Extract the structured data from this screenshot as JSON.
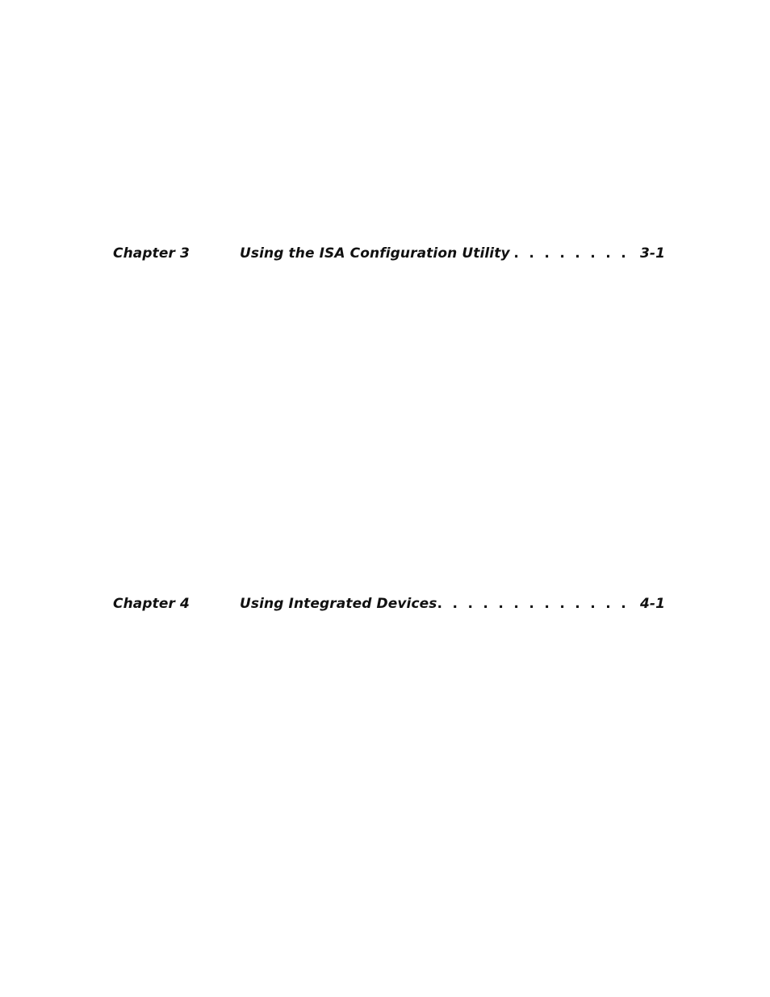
{
  "toc": {
    "entries": [
      {
        "chapter": "Chapter 3",
        "title": "Using the ISA Configuration Utility",
        "leader": ". . . . . . . . . . . . . . . . . . . . . . . . . . . . . . . . . . . . . . . .",
        "page": "3-1"
      },
      {
        "chapter": "Chapter 4",
        "title": "Using Integrated Devices",
        "leader": ". . . . . . . . . . . . . . . . . . . . . . . . . . . . . . . . . . . . . . . .",
        "page": "4-1"
      }
    ]
  }
}
